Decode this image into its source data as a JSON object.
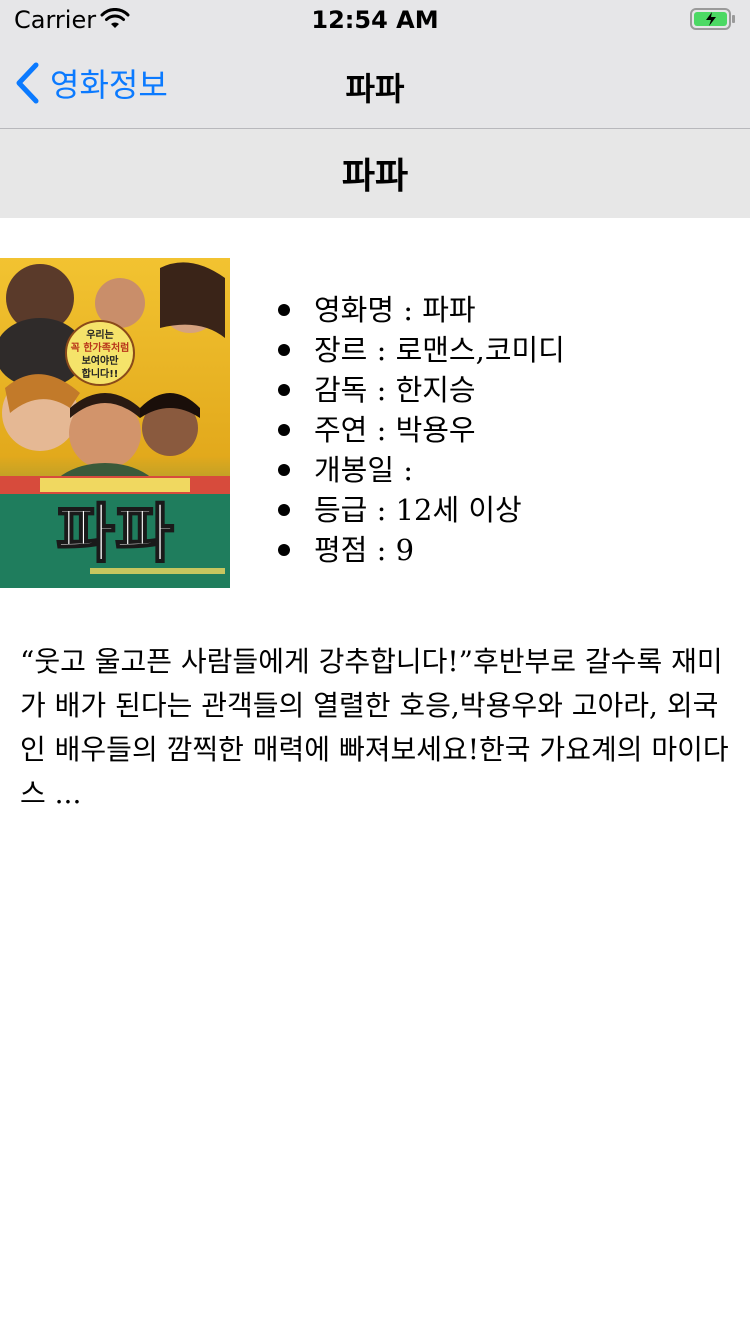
{
  "status_bar": {
    "carrier": "Carrier",
    "time": "12:54 AM",
    "battery_color": "#4cd964"
  },
  "nav": {
    "back_label": "영화정보",
    "title": "파파",
    "accent": "#0b7aff"
  },
  "header": {
    "title": "파파"
  },
  "poster": {
    "icon": "movie-poster",
    "tagline_lines": [
      "우리는",
      "꼭 한가족처럼",
      "보여야만",
      "합니다!!"
    ],
    "logo_text": "파파"
  },
  "info": [
    {
      "text": "영화명 : 파파"
    },
    {
      "text": "장르 : 로맨스,코미디"
    },
    {
      "text": "감독 : 한지승"
    },
    {
      "text": "주연 : 박용우"
    },
    {
      "text": "개봉일 :"
    },
    {
      "text": "등급 : 12세 이상"
    },
    {
      "text": "평점 : 9"
    }
  ],
  "description": "“웃고 울고픈 사람들에게 강추합니다!”후반부로 갈수록 재미가 배가 된다는 관객들의 열렬한 호응,박용우와 고아라, 외국인 배우들의 깜찍한 매력에 빠져보세요!한국 가요계의 마이다스 ..."
}
